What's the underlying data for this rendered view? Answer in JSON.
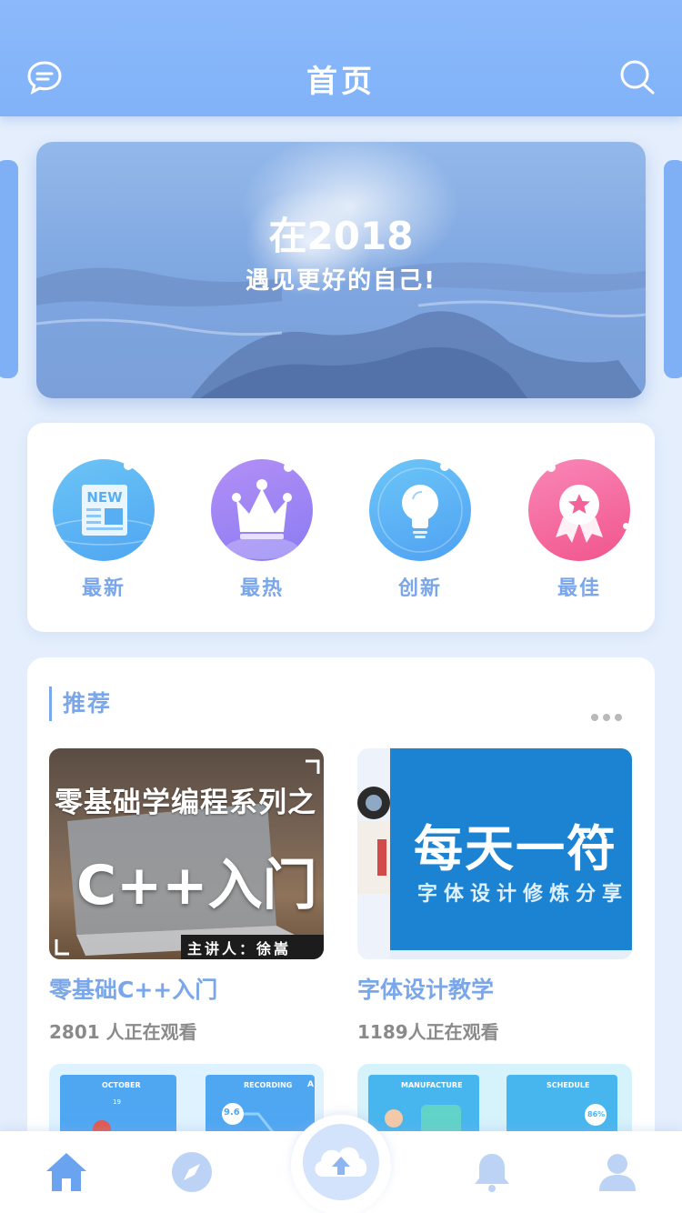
{
  "header": {
    "title": "首页",
    "left_icon": "message-icon",
    "right_icon": "search-icon"
  },
  "banner": {
    "title": "在2018",
    "subtitle": "遇见更好的自己!"
  },
  "categories": [
    {
      "label": "最新",
      "icon": "newspaper-icon",
      "color": "#5fb8f4"
    },
    {
      "label": "最热",
      "icon": "crown-icon",
      "color": "#9f84f4"
    },
    {
      "label": "创新",
      "icon": "lightbulb-icon",
      "color": "#5fb4f4"
    },
    {
      "label": "最佳",
      "icon": "award-icon",
      "color": "#f570a0"
    }
  ],
  "recommend": {
    "heading": "推荐",
    "courses": [
      {
        "title": "零基础C++入门",
        "views": "2801 人正在观看",
        "thumb_line1": "零基础学编程系列之",
        "thumb_line2": "C++入门",
        "thumb_footer": "主讲人：徐嵩"
      },
      {
        "title": "字体设计教学",
        "views": "1189人正在观看",
        "thumb_line1": "每天一符",
        "thumb_line2": "字体设计修炼分享"
      }
    ],
    "mini_cards": [
      {
        "left_label": "OCTOBER",
        "right_label": "RECORDING",
        "value_a": "9.6",
        "value_b": "19",
        "value_c": "A"
      },
      {
        "left_label": "MANUFACTURE",
        "right_label": "SCHEDULE",
        "value_a": "86%"
      }
    ]
  },
  "tabbar": {
    "items": [
      "home-icon",
      "compass-icon",
      "cloud-upload-icon",
      "bell-icon",
      "user-icon"
    ],
    "active_color": "#6aa3ef",
    "inactive_color": "#bcd3f5"
  }
}
